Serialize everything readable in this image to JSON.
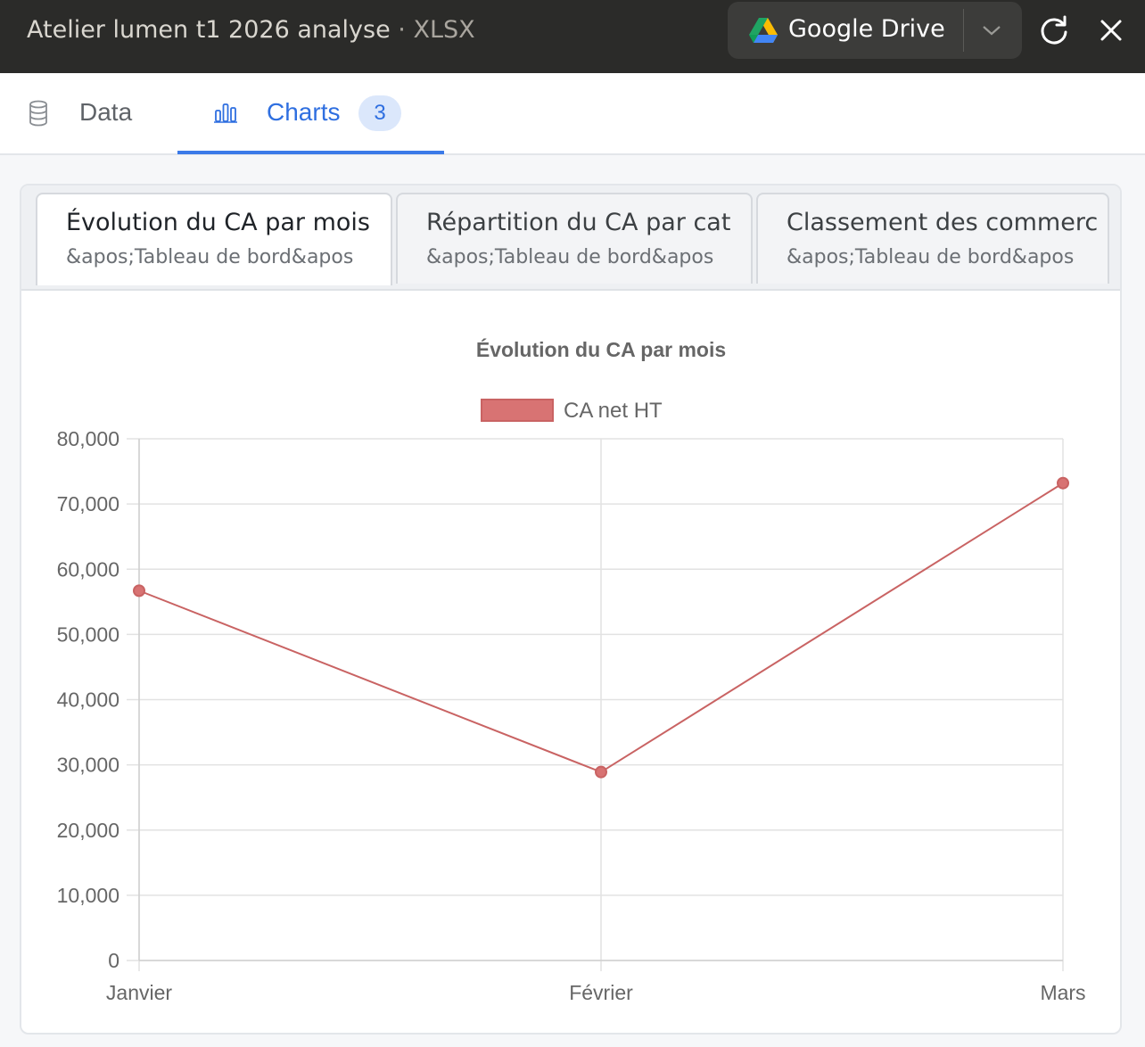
{
  "titlebar": {
    "filename": "Atelier lumen t1 2026 analyse",
    "separator": " · ",
    "extension": "XLSX",
    "drive_label": "Google Drive"
  },
  "tabs": [
    {
      "label": "Data",
      "icon": "database-icon"
    },
    {
      "label": "Charts",
      "icon": "bar-chart-icon",
      "badge": "3",
      "active": true
    }
  ],
  "chart_tabs": [
    {
      "title": "Évolution du CA par mois",
      "subtitle": "&apos;Tableau de bord&apos",
      "active": true
    },
    {
      "title": "Répartition du CA par cat",
      "subtitle": "&apos;Tableau de bord&apos"
    },
    {
      "title": "Classement des commerc",
      "subtitle": "&apos;Tableau de bord&apos"
    }
  ],
  "colors": {
    "series": "#d87373",
    "series_line": "#c96363",
    "accent": "#2f6fe0"
  },
  "chart_data": {
    "type": "line",
    "title": "Évolution du CA par mois",
    "categories": [
      "Janvier",
      "Février",
      "Mars"
    ],
    "series": [
      {
        "name": "CA net HT",
        "values": [
          56700,
          28900,
          73200
        ]
      }
    ],
    "ylim": [
      0,
      80000
    ],
    "yticks": [
      0,
      10000,
      20000,
      30000,
      40000,
      50000,
      60000,
      70000,
      80000
    ],
    "ytick_labels": [
      "0",
      "10,000",
      "20,000",
      "30,000",
      "40,000",
      "50,000",
      "60,000",
      "70,000",
      "80,000"
    ],
    "grid": true,
    "legend": "top-center"
  }
}
